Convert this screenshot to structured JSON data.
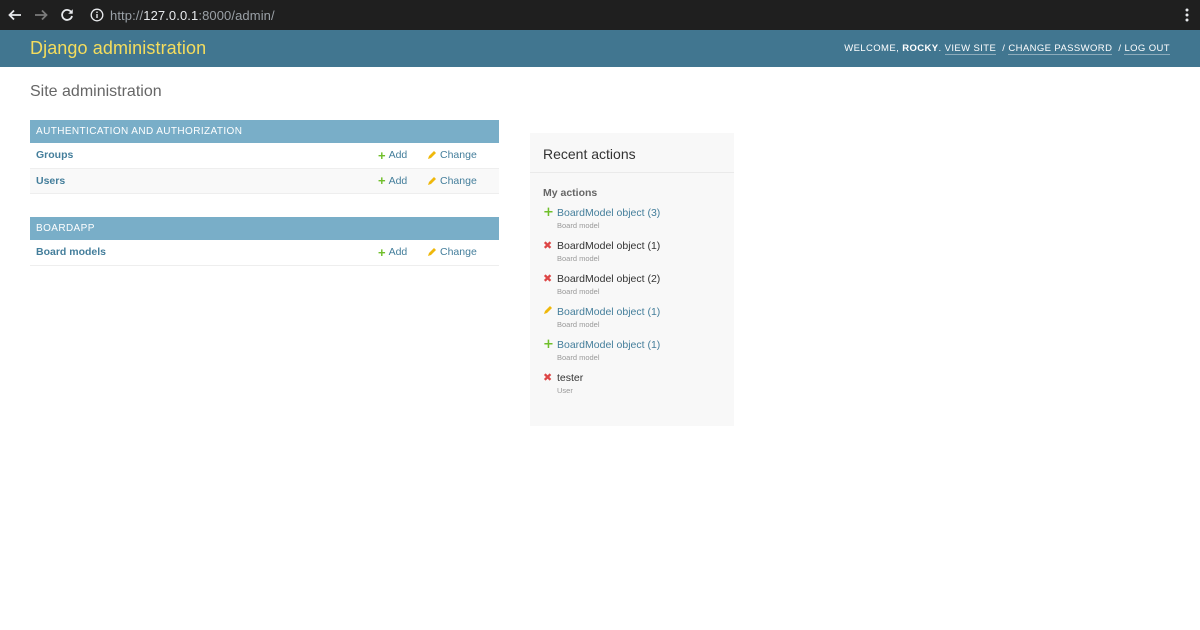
{
  "browser": {
    "url_scheme": "http://",
    "url_host": "127.0.0.1",
    "url_rest": ":8000/admin/"
  },
  "header": {
    "branding": "Django administration",
    "welcome": "WELCOME,",
    "username": "ROCKY",
    "view_site": "VIEW SITE",
    "change_password": "CHANGE PASSWORD",
    "log_out": "LOG OUT"
  },
  "page_title": "Site administration",
  "modules": [
    {
      "caption": "AUTHENTICATION AND AUTHORIZATION",
      "rows": [
        {
          "name": "Groups",
          "add": "Add",
          "change": "Change"
        },
        {
          "name": "Users",
          "add": "Add",
          "change": "Change"
        }
      ]
    },
    {
      "caption": "BOARDAPP",
      "rows": [
        {
          "name": "Board models",
          "add": "Add",
          "change": "Change"
        }
      ]
    }
  ],
  "recent_actions": {
    "title": "Recent actions",
    "subtitle": "My actions",
    "items": [
      {
        "icon": "add-icon",
        "name": "BoardModel object (3)",
        "type": "Board model"
      },
      {
        "icon": "delete-icon",
        "name": "BoardModel object (1)",
        "type": "Board model"
      },
      {
        "icon": "delete-icon",
        "name": "BoardModel object (2)",
        "type": "Board model"
      },
      {
        "icon": "change-icon",
        "name": "BoardModel object (1)",
        "type": "Board model"
      },
      {
        "icon": "add-icon",
        "name": "BoardModel object (1)",
        "type": "Board model"
      },
      {
        "icon": "delete-icon",
        "name": "tester",
        "type": "User"
      }
    ]
  },
  "colors": {
    "header_bg": "#417690",
    "branding": "#f5dd5d",
    "caption_bg": "#79aec8",
    "link": "#447e9b",
    "add": "#70bf2b",
    "delete": "#dd4646",
    "change": "#efb80b"
  }
}
